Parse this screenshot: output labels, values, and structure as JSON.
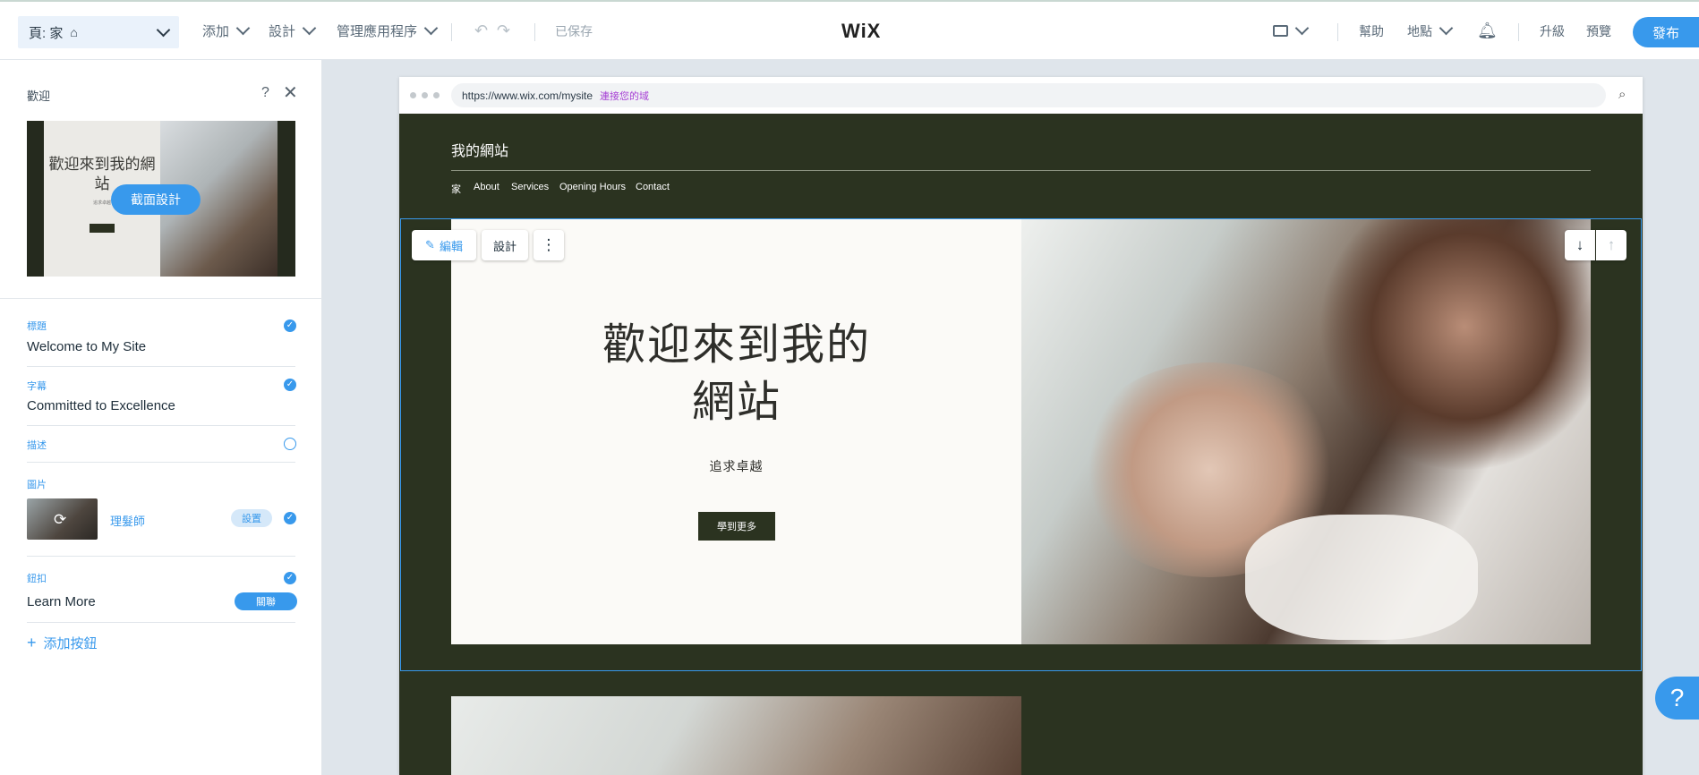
{
  "topbar": {
    "page_selector": "頁: 家",
    "menu_add": "添加",
    "menu_design": "設計",
    "menu_manage_apps": "管理應用程序",
    "saved_status": "已保存",
    "logo": "WiX",
    "help": "幫助",
    "site_menu": "地點",
    "upgrade": "升級",
    "preview": "預覽",
    "publish": "發布"
  },
  "panel": {
    "title": "歡迎",
    "thumbnail": {
      "heading": "歡迎來到我的網站",
      "sub": "追求卓越",
      "change_design_label": "截面設計"
    },
    "fields": {
      "title_label": "標題",
      "title_value": "Welcome to My Site",
      "subtitle_label": "字幕",
      "subtitle_value": "Committed to Excellence",
      "description_label": "描述",
      "image_label": "圖片",
      "image_name": "理髮師",
      "image_settings": "設置",
      "button_label": "鈕扣",
      "button_value": "Learn More",
      "button_link": "關聯"
    },
    "add_button": "添加按鈕"
  },
  "browser": {
    "url": "https://www.wix.com/mysite",
    "connect_domain": "連接您的域"
  },
  "site": {
    "title": "我的網站",
    "nav": [
      "家",
      "About",
      "Services",
      "Opening Hours",
      "Contact"
    ],
    "hero_heading": "歡迎來到我的網站",
    "hero_sub": "追求卓越",
    "hero_cta": "學到更多"
  },
  "section_toolbar": {
    "edit": "編輯",
    "design": "設計"
  },
  "colors": {
    "accent": "#3899ec",
    "site_background": "#2b3320",
    "hero_panel": "#fbfaf7"
  }
}
